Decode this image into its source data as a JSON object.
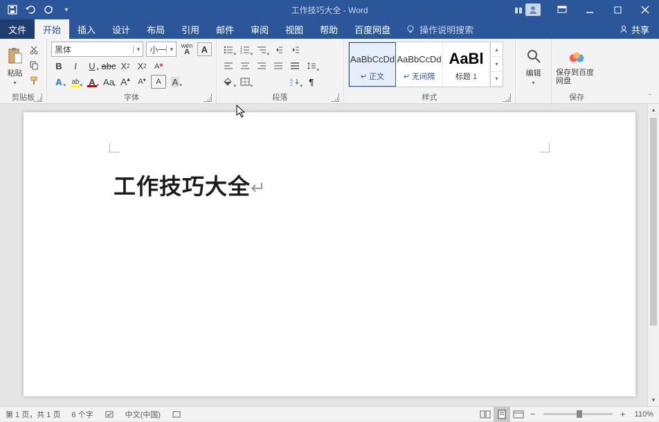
{
  "title": "工作技巧大全  -  Word",
  "tabs": {
    "file": "文件",
    "home": "开始",
    "insert": "插入",
    "design": "设计",
    "layout": "布局",
    "references": "引用",
    "mailings": "邮件",
    "review": "审阅",
    "view": "视图",
    "help": "帮助",
    "baidu": "百度网盘",
    "tell": "操作说明搜索",
    "share": "共享"
  },
  "groups": {
    "clipboard": "剪贴板",
    "font": "字体",
    "paragraph": "段落",
    "styles": "样式",
    "editing_label": "编辑",
    "save_label": "保存到百度网盘",
    "save_group": "保存"
  },
  "clipboard": {
    "paste": "粘贴"
  },
  "font": {
    "name": "黑体",
    "size": "小一",
    "phonetic": "wén",
    "charborder": "A"
  },
  "styles": [
    {
      "preview": "AaBbCcDd",
      "name": "正文",
      "link": true
    },
    {
      "preview": "AaBbCcDd",
      "name": "无间隔",
      "link": true
    },
    {
      "preview": "AaBl",
      "name": "标题 1",
      "link": false
    }
  ],
  "document": {
    "heading": "工作技巧大全"
  },
  "status": {
    "page": "第 1 页，共 1 页",
    "words": "6 个字",
    "lang": "中文(中国)",
    "zoom": "110%"
  }
}
